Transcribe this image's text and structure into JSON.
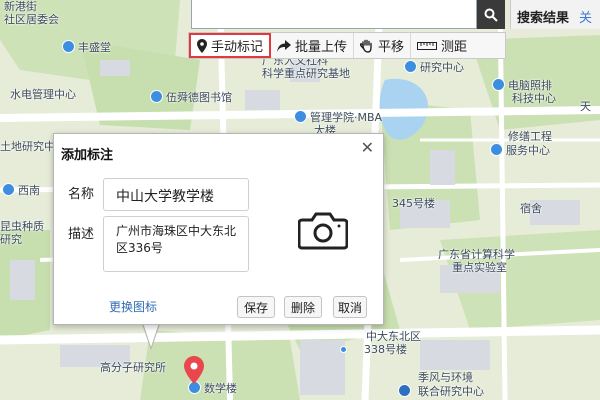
{
  "toolbar": {
    "items": [
      {
        "label": "手动标记",
        "icon": "pin-icon",
        "active": true
      },
      {
        "label": "批量上传",
        "icon": "share-arrow-icon"
      },
      {
        "label": "平移",
        "icon": "hand-icon"
      },
      {
        "label": "测距",
        "icon": "ruler-icon"
      }
    ]
  },
  "search": {
    "value": "",
    "button_icon": "search-icon"
  },
  "results_tab": {
    "label": "搜索结果",
    "next_label": "关"
  },
  "map_labels": {
    "community": [
      "新港街",
      "社区居委会"
    ],
    "fengsheng": "丰盛堂",
    "xiaodian": "水电管理中心",
    "wuxiande": "伍舜德图书馆",
    "tudi": "土地研究中心",
    "xinan": "西南",
    "kunchong": [
      "昆虫种质",
      "研究"
    ],
    "renwen": [
      "广东人文社科",
      "科学重点研究基地"
    ],
    "yanjiu": "研究中心",
    "mba": [
      "管理学院·MBA",
      "大楼"
    ],
    "diannao": [
      "电脑照排",
      "科技中心"
    ],
    "xiushan": [
      "修缮工程",
      "服务中心"
    ],
    "sushe": "宿舍",
    "building345": "345号楼",
    "jisuan": [
      "广东省计算科学",
      "重点实验室"
    ],
    "zhongda338": [
      "中大东北区",
      "338号楼"
    ],
    "gaofenzi": "高分子研究所",
    "shuxue": "数学楼",
    "jifeng": [
      "季风与环境",
      "联合研究中心"
    ],
    "tian": "天"
  },
  "dialog": {
    "title": "添加标注",
    "name_label": "名称",
    "name_value": "中山大学教学楼",
    "desc_label": "描述",
    "desc_value": "广州市海珠区中大东北区336号",
    "change_icon_label": "更换图标",
    "buttons": {
      "save": "保存",
      "delete": "删除",
      "cancel": "取消"
    },
    "close_icon": "close-icon",
    "camera_icon": "camera-icon"
  },
  "colors": {
    "map_bg": "#e7edd9",
    "green_area": "#c9e0b2",
    "road": "#ffffff",
    "building": "#dadde2",
    "water": "#aad3f2",
    "poi_blue": "#3d8ee0",
    "marker_red": "#e8474d",
    "active_border": "#e0393e"
  }
}
